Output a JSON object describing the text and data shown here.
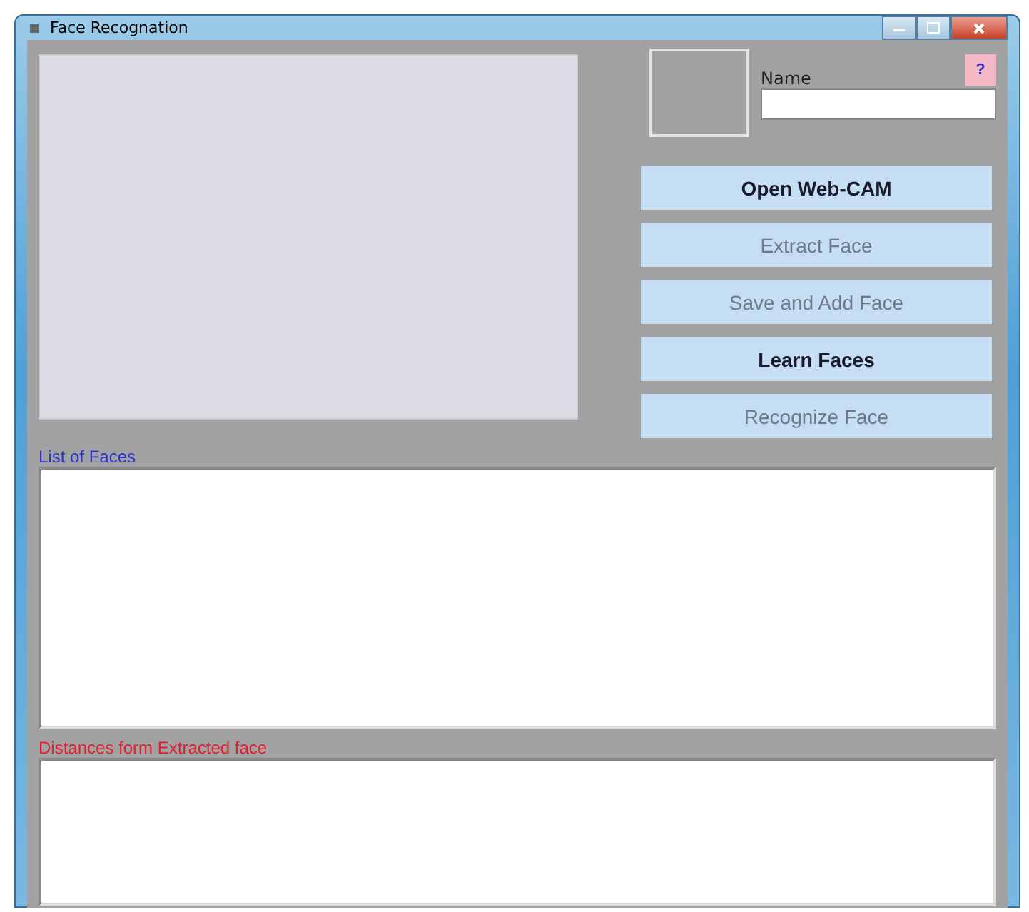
{
  "window": {
    "title": "Face Recognation"
  },
  "name_field": {
    "label": "Name"
  },
  "help_button": {
    "label": "?"
  },
  "buttons": [
    {
      "label": "Open Web-CAM",
      "disabled": false
    },
    {
      "label": "Extract Face",
      "disabled": true
    },
    {
      "label": "Save and Add Face",
      "disabled": true
    },
    {
      "label": "Learn Faces",
      "disabled": false
    },
    {
      "label": "Recognize Face",
      "disabled": true
    }
  ],
  "faces_list": {
    "label": "List of Faces"
  },
  "distances_list": {
    "label": "Distances form Extracted face"
  }
}
